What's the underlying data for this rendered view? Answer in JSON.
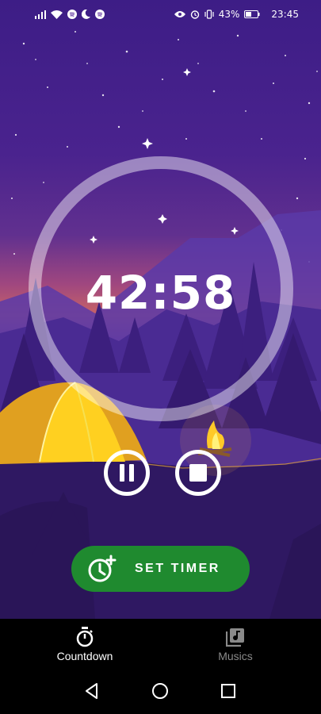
{
  "status_bar": {
    "battery": "43%",
    "time": "23:45",
    "icons": [
      "signal-icon",
      "wifi-icon",
      "spotify-icon",
      "moon-icon",
      "spotify-icon",
      "eye-icon",
      "alarm-icon",
      "vibrate-icon",
      "battery-icon"
    ]
  },
  "timer": {
    "display": "42:58",
    "ring_color": "#ffffff"
  },
  "controls": {
    "pause_icon": "pause-icon",
    "stop_icon": "stop-icon"
  },
  "set_timer": {
    "label": "SET TIMER",
    "icon": "timer-add-icon",
    "color": "#1f8a2f"
  },
  "tabs": [
    {
      "label": "Countdown",
      "icon": "stopwatch-icon",
      "active": true,
      "color": "#ffffff"
    },
    {
      "label": "Musics",
      "icon": "music-library-icon",
      "active": false,
      "color": "#8a8a8a"
    }
  ],
  "nav": [
    "back-icon",
    "home-icon",
    "recents-icon"
  ]
}
